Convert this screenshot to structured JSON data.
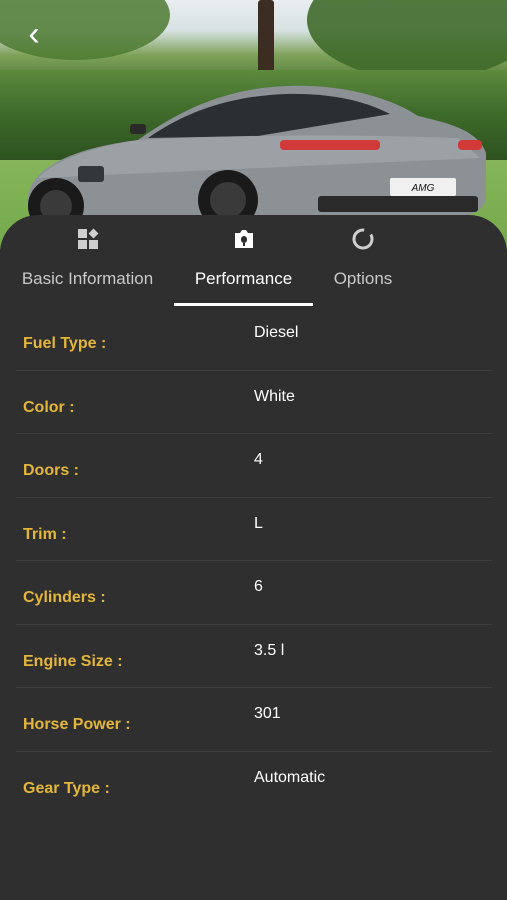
{
  "tabs": [
    {
      "label": "Basic Information",
      "icon": "grid-icon"
    },
    {
      "label": "Performance",
      "icon": "camera-icon"
    },
    {
      "label": "Options",
      "icon": "options-icon"
    }
  ],
  "active_tab": "Performance",
  "details": [
    {
      "label": "Fuel Type :",
      "value": "Diesel"
    },
    {
      "label": "Color :",
      "value": "White"
    },
    {
      "label": "Doors :",
      "value": "4"
    },
    {
      "label": "Trim :",
      "value": "L"
    },
    {
      "label": "Cylinders :",
      "value": "6"
    },
    {
      "label": "Engine Size :",
      "value": "3.5 l"
    },
    {
      "label": "Horse Power :",
      "value": "301"
    },
    {
      "label": "Gear Type :",
      "value": "Automatic"
    }
  ],
  "hero": {
    "plate_text": "AMG"
  },
  "colors": {
    "accent": "#e4b63a",
    "background": "#2f2f2f"
  }
}
